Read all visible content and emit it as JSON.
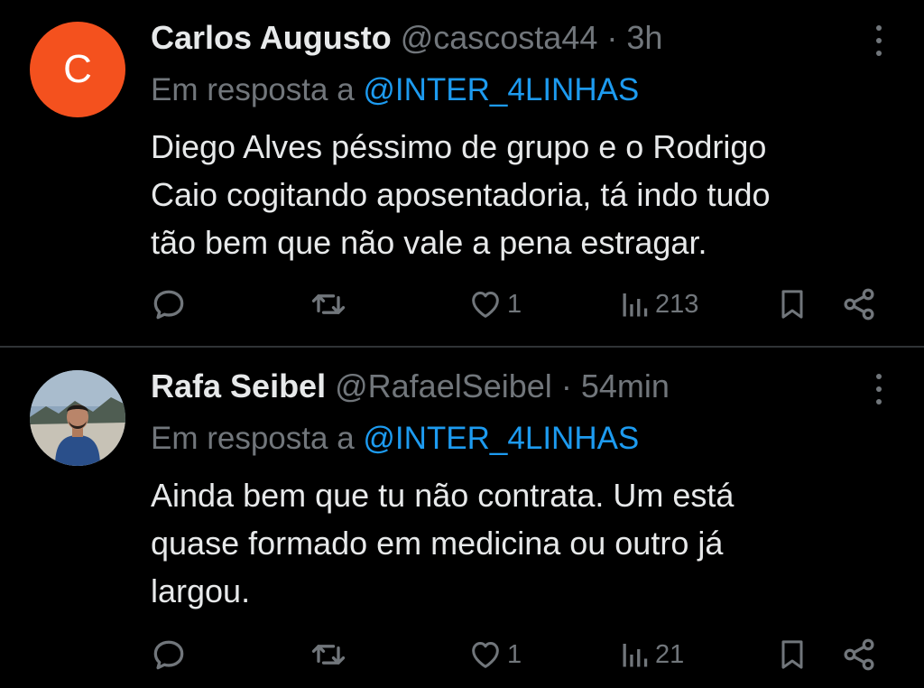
{
  "colors": {
    "background": "#000000",
    "text": "#e7e9ea",
    "muted": "#71767b",
    "link": "#1d9bf0",
    "avatar_c": "#f4511e",
    "divider": "#2f3336"
  },
  "tweets": [
    {
      "avatar_letter": "C",
      "name": "Carlos Augusto",
      "handle": "@cascosta44",
      "dot": "·",
      "time": "3h",
      "reply_prefix": "Em resposta a ",
      "reply_handle": "@INTER_4LINHAS",
      "text_lines": [
        "Diego Alves péssimo de grupo e o Rodrigo",
        "Caio cogitando aposentadoria, tá indo tudo",
        "tão bem que não vale a pena estragar."
      ],
      "likes": "1",
      "views": "213",
      "icons": {
        "more": "more-vertical-icon",
        "reply": "reply-icon",
        "retweet": "retweet-icon",
        "like": "heart-icon",
        "views": "views-icon",
        "bookmark": "bookmark-icon",
        "share": "share-icon"
      }
    },
    {
      "avatar_letter": "",
      "name": "Rafa Seibel",
      "handle": "@RafaelSeibel",
      "dot": "·",
      "time": "54min",
      "reply_prefix": "Em resposta a ",
      "reply_handle": "@INTER_4LINHAS",
      "text_lines": [
        "Ainda bem que tu não contrata. Um está",
        "quase formado em medicina ou outro já",
        "largou."
      ],
      "likes": "1",
      "views": "21",
      "icons": {
        "more": "more-vertical-icon",
        "reply": "reply-icon",
        "retweet": "retweet-icon",
        "like": "heart-icon",
        "views": "views-icon",
        "bookmark": "bookmark-icon",
        "share": "share-icon"
      }
    }
  ]
}
